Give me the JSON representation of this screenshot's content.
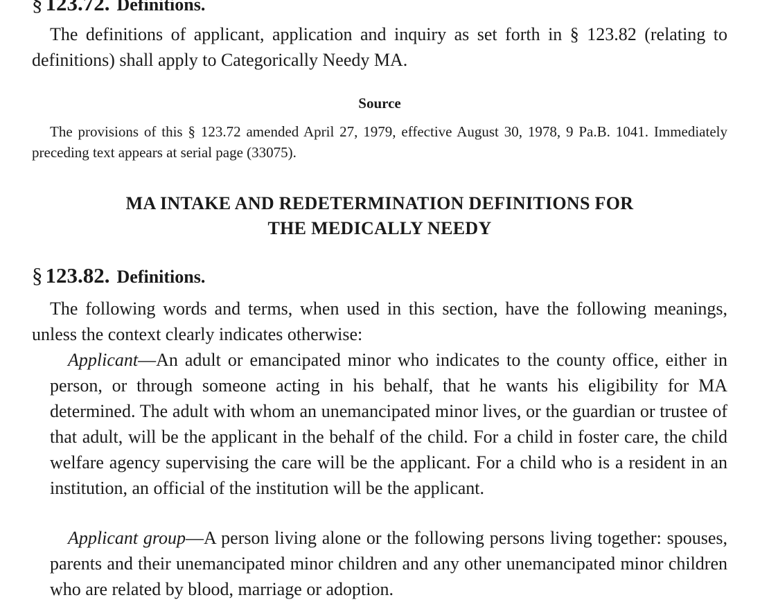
{
  "section_123_72": {
    "symbol": "§",
    "number": "123.72.",
    "title": "Definitions.",
    "body": "The definitions of applicant, application and inquiry as set forth in § 123.82 (relating to definitions) shall apply to Categorically Needy MA."
  },
  "source": {
    "heading": "Source",
    "text": "The provisions of this § 123.72 amended April 27, 1979, effective August 30, 1978, 9 Pa.B. 1041. Immediately preceding text appears at serial page (33075)."
  },
  "chapter_heading": {
    "line1": "MA INTAKE AND REDETERMINATION DEFINITIONS FOR",
    "line2": "THE MEDICALLY NEEDY"
  },
  "section_123_82": {
    "symbol": "§",
    "number": "123.82.",
    "title": "Definitions.",
    "intro": "The following words and terms, when used in this section, have the following meanings, unless the context clearly indicates otherwise:",
    "definitions": [
      {
        "term": "Applicant",
        "dash": "—",
        "text": "An adult or emancipated minor who indicates to the county office, either in person, or through someone acting in his behalf, that he wants his eligibility for MA determined. The adult with whom an unemancipated minor lives, or the guardian or trustee of that adult, will be the applicant in the behalf of the child. For a child in foster care, the child welfare agency supervising the care will be the applicant. For a child who is a resident in an institution, an official of the institution will be the applicant."
      },
      {
        "term": "Applicant group",
        "dash": "—",
        "text": "A person living alone or the following persons living together: spouses, parents and their unemancipated minor children and any other unemancipated minor children who are related by blood, marriage or adoption."
      }
    ]
  }
}
